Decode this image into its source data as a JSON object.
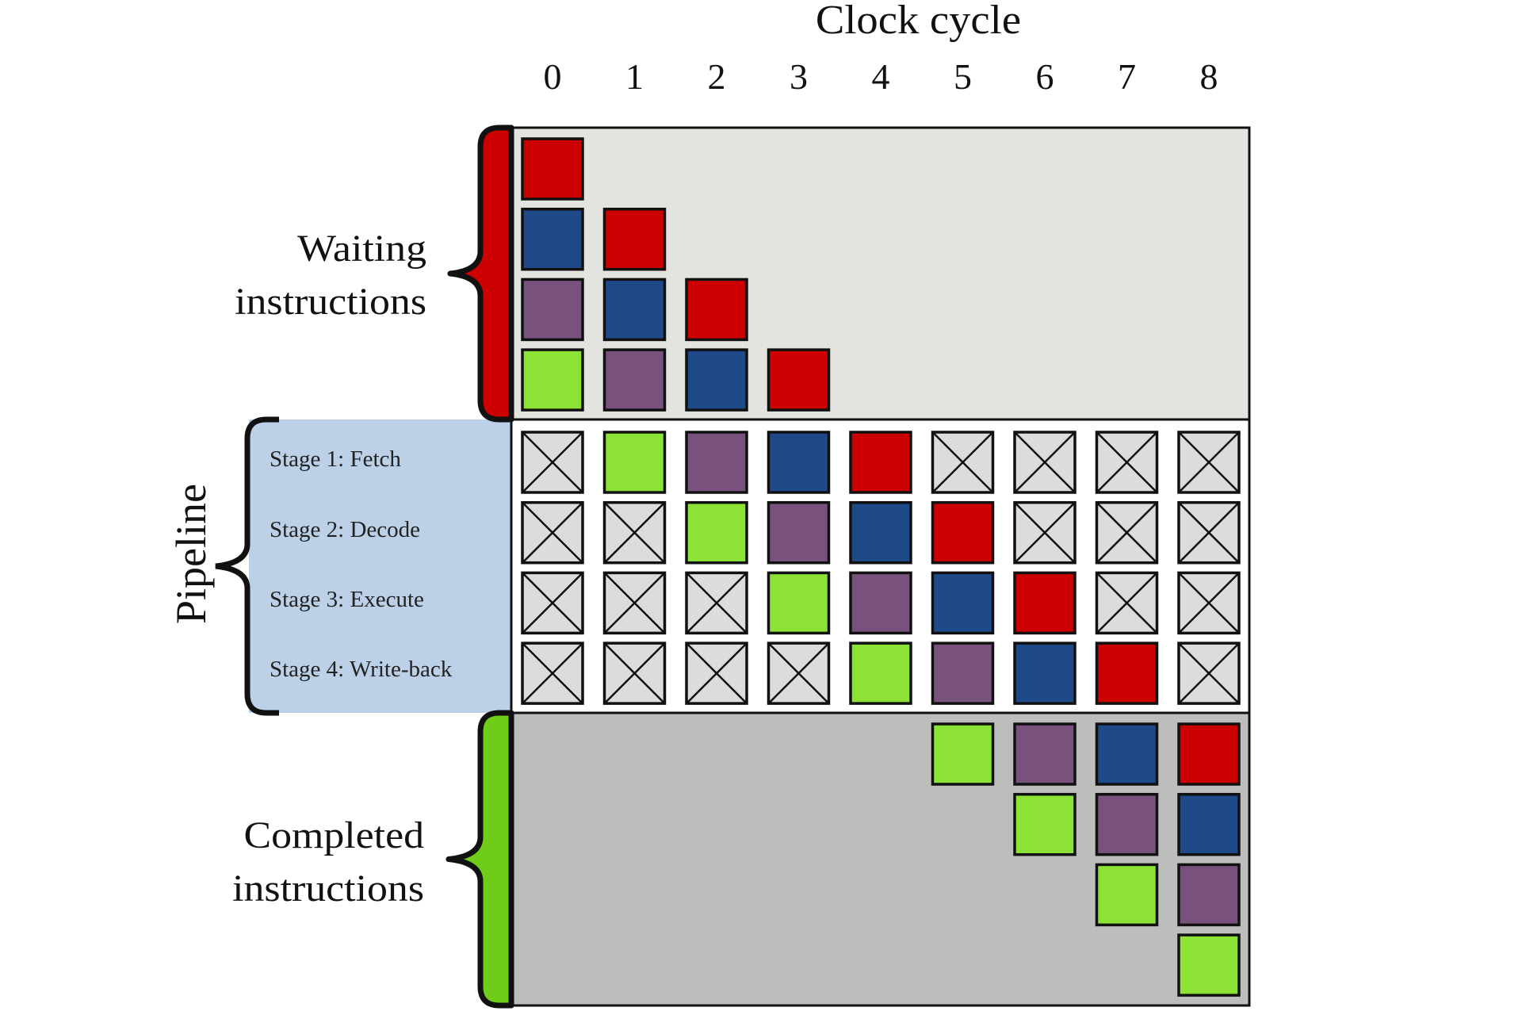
{
  "title": "Clock cycle",
  "cycles": [
    "0",
    "1",
    "2",
    "3",
    "4",
    "5",
    "6",
    "7",
    "8"
  ],
  "colors": {
    "red": "#cc0000",
    "blue": "#1f4a89",
    "purple": "#78527c",
    "green": "#8de236",
    "empty_fill": "#dcdcda",
    "waiting_bg": "#e3e4e0",
    "pipeline_bg": "#ffffff",
    "completed_bg": "#bdbebb",
    "pipeline_label_bg": "#bcd0e8",
    "waiting_brace": "#cc0000",
    "completed_brace": "#6fcc19",
    "outline": "#111111"
  },
  "instructions": [
    {
      "id": "I0",
      "color": "red"
    },
    {
      "id": "I1",
      "color": "blue"
    },
    {
      "id": "I2",
      "color": "purple"
    },
    {
      "id": "I3",
      "color": "green"
    }
  ],
  "waiting": {
    "label_line1": "Waiting",
    "label_line2": "instructions",
    "rows": [
      [
        "red",
        null,
        null,
        null,
        null,
        null,
        null,
        null,
        null
      ],
      [
        "blue",
        "red",
        null,
        null,
        null,
        null,
        null,
        null,
        null
      ],
      [
        "purple",
        "blue",
        "red",
        null,
        null,
        null,
        null,
        null,
        null
      ],
      [
        "green",
        "purple",
        "blue",
        "red",
        null,
        null,
        null,
        null,
        null
      ]
    ]
  },
  "pipeline": {
    "label": "Pipeline",
    "stages": [
      {
        "label": "Stage 1: Fetch",
        "cells": [
          "empty",
          "green",
          "purple",
          "blue",
          "red",
          "empty",
          "empty",
          "empty",
          "empty"
        ]
      },
      {
        "label": "Stage 2: Decode",
        "cells": [
          "empty",
          "empty",
          "green",
          "purple",
          "blue",
          "red",
          "empty",
          "empty",
          "empty"
        ]
      },
      {
        "label": "Stage 3: Execute",
        "cells": [
          "empty",
          "empty",
          "empty",
          "green",
          "purple",
          "blue",
          "red",
          "empty",
          "empty"
        ]
      },
      {
        "label": "Stage 4: Write-back",
        "cells": [
          "empty",
          "empty",
          "empty",
          "empty",
          "green",
          "purple",
          "blue",
          "red",
          "empty"
        ]
      }
    ]
  },
  "completed": {
    "label_line1": "Completed",
    "label_line2": "instructions",
    "rows": [
      [
        null,
        null,
        null,
        null,
        null,
        "green",
        "purple",
        "blue",
        "red"
      ],
      [
        null,
        null,
        null,
        null,
        null,
        null,
        "green",
        "purple",
        "blue"
      ],
      [
        null,
        null,
        null,
        null,
        null,
        null,
        null,
        "green",
        "purple"
      ],
      [
        null,
        null,
        null,
        null,
        null,
        null,
        null,
        null,
        "green"
      ]
    ]
  }
}
